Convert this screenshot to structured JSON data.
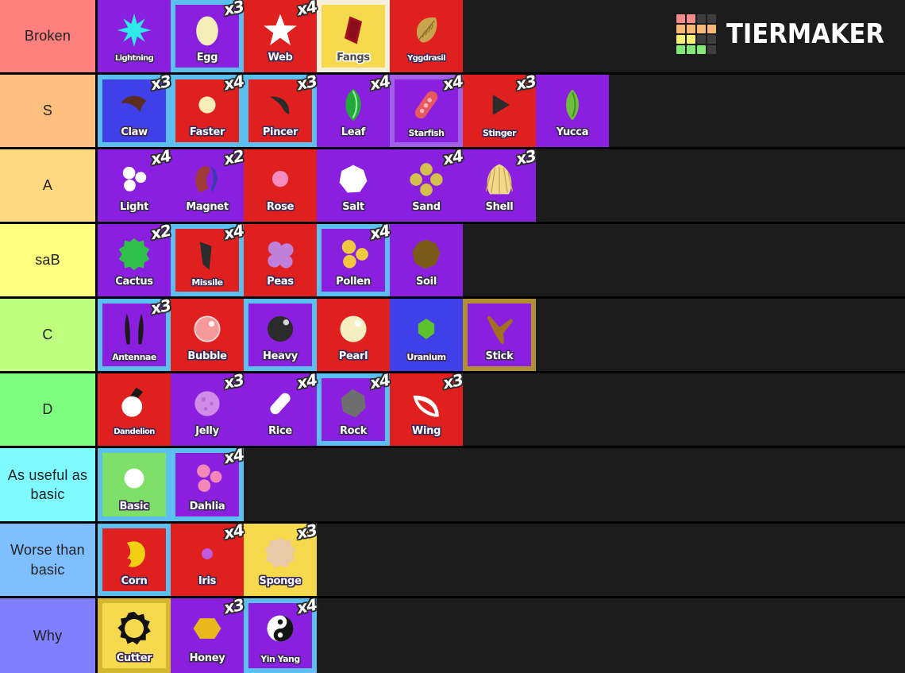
{
  "logo": {
    "text": "TIERMAKER",
    "grid_colors": [
      "#f58a8a",
      "#f58a8a",
      "#3d3d3d",
      "#3d3d3d",
      "#f8b878",
      "#f8b878",
      "#f8b878",
      "#f8b878",
      "#f8f178",
      "#f8f178",
      "#3d3d3d",
      "#3d3d3d",
      "#84e878",
      "#84e878",
      "#84e878",
      "#3d3d3d"
    ]
  },
  "background": "#1c1c1c",
  "rows": [
    {
      "label": "Broken",
      "color": "#ff7f7f",
      "items": [
        {
          "name": "Lightning",
          "bg": "#8a1fe0",
          "border": "#8a1fe0",
          "mult": null,
          "icon": "lightning-starburst",
          "icon_color": "#2fe8e8"
        },
        {
          "name": "Egg",
          "bg": "#8a1fe0",
          "border": "#5bc0f0",
          "mult": "x3",
          "icon": "egg-oval",
          "icon_color": "#f5eeb8"
        },
        {
          "name": "Web",
          "bg": "#e01f1f",
          "border": "#e01f1f",
          "mult": "x4",
          "icon": "web-star",
          "icon_color": "#ffffff"
        },
        {
          "name": "Fangs",
          "bg": "#f7d94e",
          "border": "#f5f0dc",
          "mult": null,
          "icon": "fangs-diamond",
          "icon_color": "#a01020",
          "label_color": "#4a4a4a"
        },
        {
          "name": "Yggdrasil",
          "bg": "#e01f1f",
          "border": "#e01f1f",
          "mult": null,
          "icon": "yggdrasil-leaf",
          "icon_color": "#c9a44c"
        }
      ]
    },
    {
      "label": "S",
      "color": "#ffbf7f",
      "items": [
        {
          "name": "Claw",
          "bg": "#4040e8",
          "border": "#5bc0f0",
          "mult": "x3",
          "icon": "claw-curve",
          "icon_color": "#5a2d20"
        },
        {
          "name": "Faster",
          "bg": "#e01f1f",
          "border": "#5bc0f0",
          "mult": "x4",
          "icon": "faster-circle",
          "icon_color": "#f5eeb8"
        },
        {
          "name": "Pincer",
          "bg": "#e01f1f",
          "border": "#5bc0f0",
          "mult": "x3",
          "icon": "pincer-hook",
          "icon_color": "#2b2b2b"
        },
        {
          "name": "Leaf",
          "bg": "#8a1fe0",
          "border": "#8a1fe0",
          "mult": "x4",
          "icon": "leaf-green",
          "icon_color": "#24a83c"
        },
        {
          "name": "Starfish",
          "bg": "#8a1fe0",
          "border": "#a060e8",
          "mult": "x4",
          "icon": "starfish-arm",
          "icon_color": "#e8585f"
        },
        {
          "name": "Stinger",
          "bg": "#e01f1f",
          "border": "#e01f1f",
          "mult": "x3",
          "icon": "stinger-triangle",
          "icon_color": "#2b2b2b"
        },
        {
          "name": "Yucca",
          "bg": "#8a1fe0",
          "border": "#8a1fe0",
          "mult": null,
          "icon": "yucca-leaf",
          "icon_color": "#6fbf3c"
        }
      ]
    },
    {
      "label": "A",
      "color": "#ffd97f",
      "items": [
        {
          "name": "Light",
          "bg": "#8a1fe0",
          "border": "#8a1fe0",
          "mult": "x4",
          "icon": "light-orbs",
          "icon_color": "#ffffff"
        },
        {
          "name": "Magnet",
          "bg": "#8a1fe0",
          "border": "#8a1fe0",
          "mult": "x2",
          "icon": "magnet-horseshoe",
          "icon_color": "#a03a36"
        },
        {
          "name": "Rose",
          "bg": "#e01f1f",
          "border": "#e01f1f",
          "mult": null,
          "icon": "rose-circle",
          "icon_color": "#f58cc0"
        },
        {
          "name": "Salt",
          "bg": "#8a1fe0",
          "border": "#8a1fe0",
          "mult": null,
          "icon": "salt-crystal",
          "icon_color": "#ffffff"
        },
        {
          "name": "Sand",
          "bg": "#8a1fe0",
          "border": "#8a1fe0",
          "mult": "x4",
          "icon": "sand-cluster",
          "icon_color": "#d4c04c"
        },
        {
          "name": "Shell",
          "bg": "#8a1fe0",
          "border": "#8a1fe0",
          "mult": "x3",
          "icon": "shell-fan",
          "icon_color": "#f0d98c"
        }
      ]
    },
    {
      "label": "saB",
      "color": "#ffff7f",
      "items": [
        {
          "name": "Cactus",
          "bg": "#8a1fe0",
          "border": "#8a1fe0",
          "mult": "x2",
          "icon": "cactus-blob",
          "icon_color": "#2fc04c"
        },
        {
          "name": "Missile",
          "bg": "#e01f1f",
          "border": "#5bc0f0",
          "mult": "x4",
          "icon": "missile-cone",
          "icon_color": "#2b2b2b"
        },
        {
          "name": "Peas",
          "bg": "#e01f1f",
          "border": "#e01f1f",
          "mult": null,
          "icon": "peas-cluster",
          "icon_color": "#c07fd8"
        },
        {
          "name": "Pollen",
          "bg": "#8a1fe0",
          "border": "#5bc0f0",
          "mult": "x4",
          "icon": "pollen-cluster",
          "icon_color": "#f0c840"
        },
        {
          "name": "Soil",
          "bg": "#8a1fe0",
          "border": "#8a1fe0",
          "mult": null,
          "icon": "soil-blob",
          "icon_color": "#7a5a18"
        }
      ]
    },
    {
      "label": "C",
      "color": "#bfff7f",
      "items": [
        {
          "name": "Antennae",
          "bg": "#8a1fe0",
          "border": "#5bc0f0",
          "mult": "x3",
          "icon": "antennae-pair",
          "icon_color": "#1a1a1a"
        },
        {
          "name": "Bubble",
          "bg": "#e01f1f",
          "border": "#e01f1f",
          "mult": null,
          "icon": "bubble-sphere",
          "icon_color": "#f59a9a"
        },
        {
          "name": "Heavy",
          "bg": "#8a1fe0",
          "border": "#5bc0f0",
          "mult": null,
          "icon": "heavy-ball",
          "icon_color": "#2b2b2b"
        },
        {
          "name": "Pearl",
          "bg": "#e01f1f",
          "border": "#e01f1f",
          "mult": null,
          "icon": "pearl-sphere",
          "icon_color": "#f5eec0"
        },
        {
          "name": "Uranium",
          "bg": "#4040e8",
          "border": "#4040e8",
          "mult": null,
          "icon": "uranium-crystal",
          "icon_color": "#5cc22c"
        },
        {
          "name": "Stick",
          "bg": "#8a1fe0",
          "border": "#b09030",
          "mult": null,
          "icon": "stick-branch",
          "icon_color": "#a07020"
        }
      ]
    },
    {
      "label": "D",
      "color": "#7fff7f",
      "items": [
        {
          "name": "Dandelion",
          "bg": "#e01f1f",
          "border": "#e01f1f",
          "mult": null,
          "icon": "dandelion-puff",
          "icon_color": "#ffffff"
        },
        {
          "name": "Jelly",
          "bg": "#8a1fe0",
          "border": "#8a1fe0",
          "mult": "x3",
          "icon": "jelly-sphere",
          "icon_color": "#d08ce8"
        },
        {
          "name": "Rice",
          "bg": "#8a1fe0",
          "border": "#8a1fe0",
          "mult": "x4",
          "icon": "rice-grain",
          "icon_color": "#ffffff"
        },
        {
          "name": "Rock",
          "bg": "#8a1fe0",
          "border": "#5bc0f0",
          "mult": "x4",
          "icon": "rock-chunk",
          "icon_color": "#6e6e6e"
        },
        {
          "name": "Wing",
          "bg": "#e01f1f",
          "border": "#e01f1f",
          "mult": "x3",
          "icon": "wing-crescent",
          "icon_color": "#ffffff"
        }
      ]
    },
    {
      "label": "As useful as basic",
      "color": "#7ffaff",
      "items": [
        {
          "name": "Basic",
          "bg": "#7fe069",
          "border": "#5bc0f0",
          "mult": null,
          "icon": "basic-circle",
          "icon_color": "#ffffff"
        },
        {
          "name": "Dahlia",
          "bg": "#8a1fe0",
          "border": "#5bc0f0",
          "mult": "x4",
          "icon": "dahlia-cluster",
          "icon_color": "#f287b8"
        }
      ]
    },
    {
      "label": "Worse than basic",
      "color": "#7fbfff",
      "items": [
        {
          "name": "Corn",
          "bg": "#e01f1f",
          "border": "#5bc0f0",
          "mult": null,
          "icon": "corn-kernel",
          "icon_color": "#f0d010"
        },
        {
          "name": "Iris",
          "bg": "#e01f1f",
          "border": "#e01f1f",
          "mult": "x4",
          "icon": "iris-dot",
          "icon_color": "#c05ce0"
        },
        {
          "name": "Sponge",
          "bg": "#f7d94e",
          "border": "#f7d94e",
          "mult": "x3",
          "icon": "sponge-blob",
          "icon_color": "#e8c9a8"
        }
      ]
    },
    {
      "label": "Why",
      "color": "#7f7fff",
      "items": [
        {
          "name": "Cutter",
          "bg": "#f7d94e",
          "border": "#d4b830",
          "mult": null,
          "icon": "cutter-gear",
          "icon_color": "#111111"
        },
        {
          "name": "Honey",
          "bg": "#8a1fe0",
          "border": "#8a1fe0",
          "mult": "x3",
          "icon": "honey-hex",
          "icon_color": "#e8b81c"
        },
        {
          "name": "Yin Yang",
          "bg": "#8a1fe0",
          "border": "#5bc0f0",
          "mult": "x4",
          "icon": "yinyang-symbol",
          "icon_color": "#ffffff"
        }
      ]
    }
  ]
}
